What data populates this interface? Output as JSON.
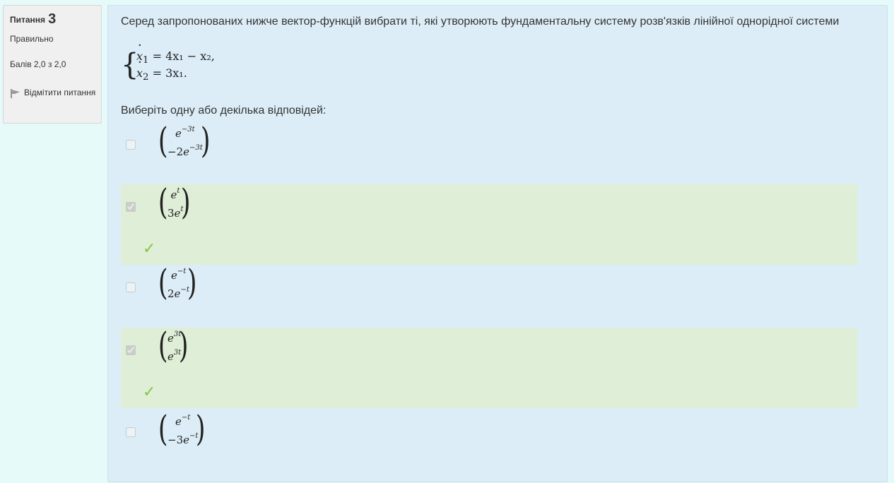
{
  "info": {
    "question_label": "Питання",
    "question_number": "3",
    "state": "Правильно",
    "grade": "Балів 2,0 з 2,0",
    "flag_label": "Відмітити питання",
    "flag_icon": "flag-icon"
  },
  "question": {
    "text": "Серед запропонованих нижче вектор-функцій вибрати ті, які утворюють фундаментальну систему розв'язків лінійної однорідної системи",
    "equation1_lhs": "x",
    "equation1_sub": "1",
    "equation1_rhs": "= 4x₁ − x₂,",
    "equation2_lhs": "x",
    "equation2_sub": "2",
    "equation2_rhs": "= 3x₁.",
    "prompt": "Виберіть одну або декілька відповідей:"
  },
  "options": [
    {
      "top_coef": "",
      "top_exp": "−3t",
      "bottom_coef": "−2",
      "bottom_exp": "−3t",
      "checked": false,
      "correct": false
    },
    {
      "top_coef": "",
      "top_exp": "t",
      "bottom_coef": "3",
      "bottom_exp": "t",
      "checked": true,
      "correct": true
    },
    {
      "top_coef": "",
      "top_exp": "−t",
      "bottom_coef": "2",
      "bottom_exp": "−t",
      "checked": false,
      "correct": false
    },
    {
      "top_coef": "",
      "top_exp": "3t",
      "bottom_coef": "",
      "bottom_exp": "3t",
      "checked": true,
      "correct": true
    },
    {
      "top_coef": "",
      "top_exp": "−t",
      "bottom_coef": "−3",
      "bottom_exp": "−t",
      "checked": false,
      "correct": false
    }
  ],
  "check_mark": "✓",
  "base_letter": "e",
  "colors": {
    "correct_bg": "#dfeed6",
    "panel_bg": "#dcedf7",
    "check": "#8bc34a"
  }
}
